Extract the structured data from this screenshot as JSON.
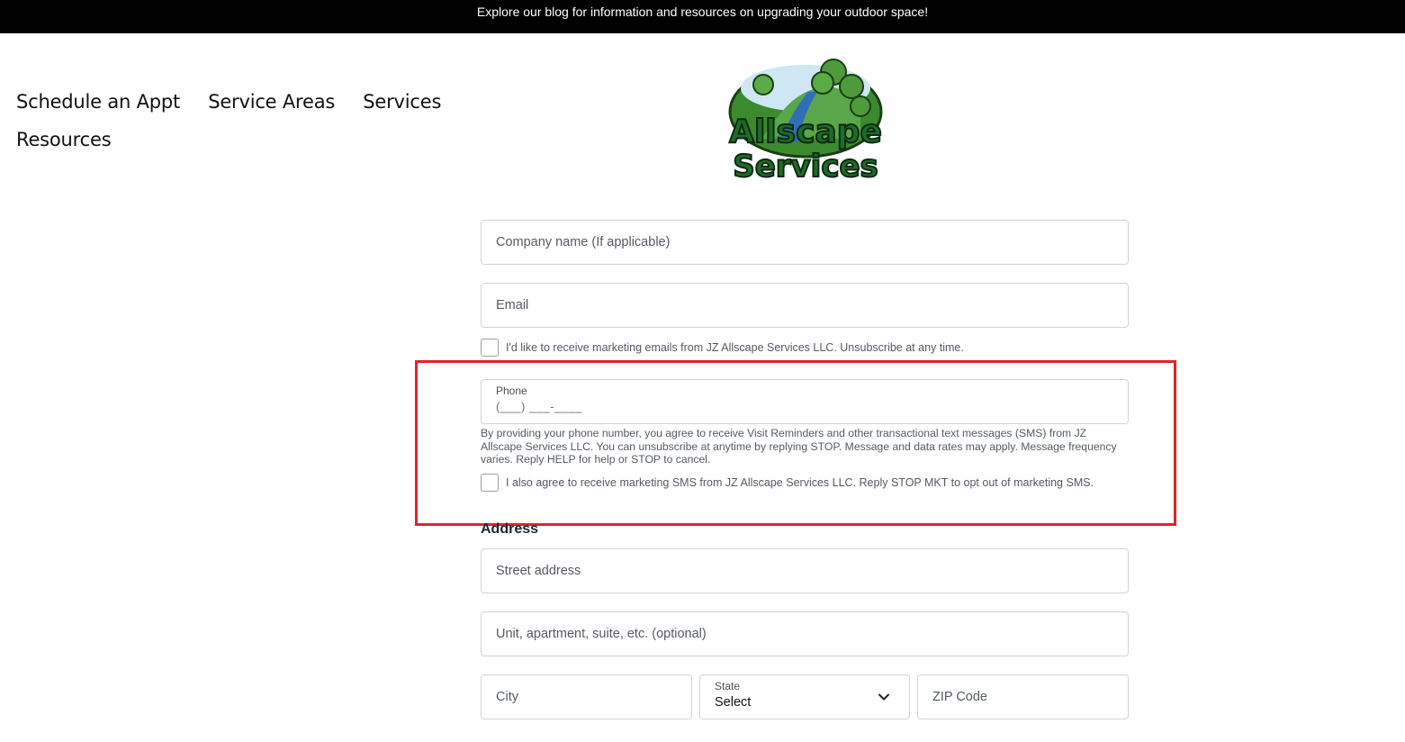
{
  "banner": {
    "text": "Explore our blog for information and resources on upgrading your outdoor space!"
  },
  "nav": {
    "items": [
      {
        "label": "Schedule an Appt"
      },
      {
        "label": "Service Areas"
      },
      {
        "label": "Services"
      },
      {
        "label": "Resources"
      }
    ]
  },
  "logo": {
    "line1": "Allscape",
    "line2": "Services"
  },
  "form": {
    "company_placeholder": "Company name (If applicable)",
    "email_placeholder": "Email",
    "email_optin": "I'd like to receive marketing emails from JZ Allscape Services LLC. Unsubscribe at any time.",
    "phone_label": "Phone",
    "phone_mask": "(___) ___-____",
    "sms_note": "By providing your phone number, you agree to receive Visit Reminders and other transactional text messages (SMS) from JZ Allscape Services LLC. You can unsubscribe at anytime by replying STOP. Message and data rates may apply. Message frequency varies. Reply HELP for help or STOP to cancel.",
    "sms_optin": "I also agree to receive marketing SMS from JZ Allscape Services LLC. Reply STOP MKT to opt out of marketing SMS.",
    "address_title": "Address",
    "street_placeholder": "Street address",
    "unit_placeholder": "Unit, apartment, suite, etc. (optional)",
    "city_placeholder": "City",
    "state_label": "State",
    "state_value": "Select",
    "zip_placeholder": "ZIP Code"
  },
  "colors": {
    "banner_bg": "#000000",
    "highlight_border": "#e0242b",
    "logo_green": "#1f6b2a",
    "field_border": "#d3d3d6"
  },
  "icons": {
    "state_dropdown": "chevron-down-icon"
  }
}
